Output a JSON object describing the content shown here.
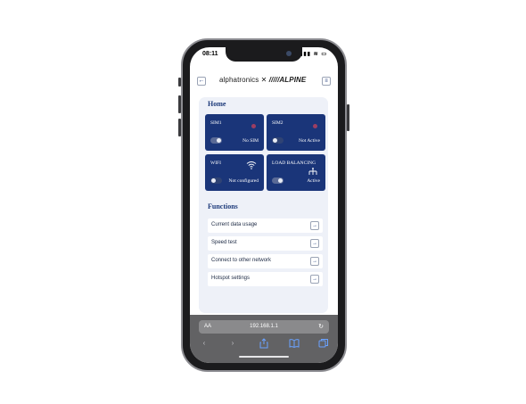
{
  "status": {
    "time": "08:11",
    "icons": "▮▮▮ ≋ ▭"
  },
  "header": {
    "brand_part1": "alphatronics ✕ ",
    "brand_part2": "/////ALPINE",
    "back_icon": "←",
    "menu_icon": "≡"
  },
  "home": {
    "title": "Home",
    "tiles": [
      {
        "name": "SIM1",
        "status": "No SIM",
        "toggle": "on"
      },
      {
        "name": "SIM2",
        "status": "Not Active",
        "toggle": "off"
      },
      {
        "name": "WIFI",
        "status": "Not configured",
        "toggle": "off",
        "icon": "wifi-icon"
      },
      {
        "name": "LOAD BALANCING",
        "status": "Active",
        "toggle": "on",
        "icon": "network-icon"
      }
    ]
  },
  "functions": {
    "title": "Functions",
    "items": [
      {
        "label": "Current data usage"
      },
      {
        "label": "Speed test"
      },
      {
        "label": "Connect to other network"
      },
      {
        "label": "Hotspot settings"
      }
    ],
    "arrow_icon": "→"
  },
  "browser": {
    "aa": "AA",
    "url": "192.168.1.1",
    "reload": "↻"
  },
  "colors": {
    "tile": "#1a3579",
    "accent": "#1d3a7a",
    "content_bg": "#eef1f8"
  }
}
